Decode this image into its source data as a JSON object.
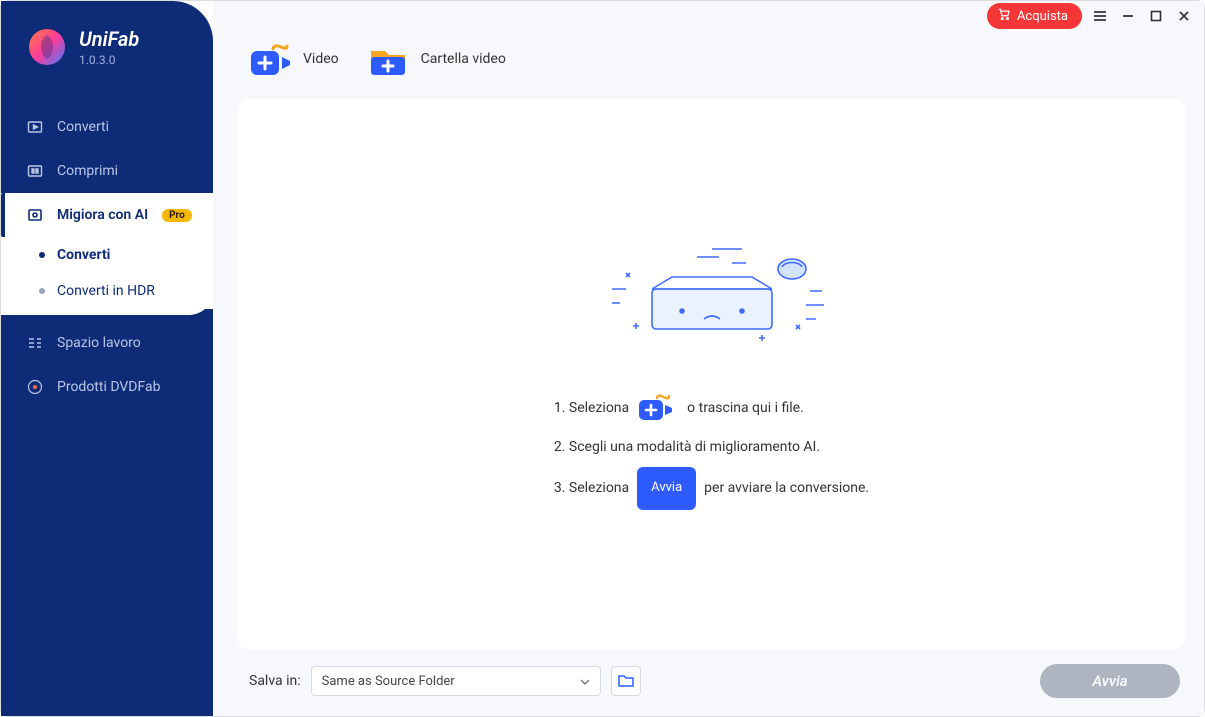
{
  "titlebar": {
    "buy_label": "Acquista"
  },
  "brand": {
    "name": "UniFab",
    "version": "1.0.3.0"
  },
  "sidebar": {
    "convert": "Converti",
    "compress": "Comprimi",
    "enhance_ai": "Migiora con AI",
    "pro_badge": "Pro",
    "sub_convert": "Converti",
    "sub_convert_hdr": "Converti in HDR",
    "workspace": "Spazio lavoro",
    "dvdfab_products": "Prodotti DVDFab"
  },
  "toolbar": {
    "video": "Video",
    "video_folder": "Cartella video"
  },
  "steps": {
    "s1a": "1. Seleziona",
    "s1b": "o trascina qui i file.",
    "s2": "2. Scegli una modalità di miglioramento AI.",
    "s3a": "3. Seleziona",
    "s3_chip": "Avvia",
    "s3b": "per avviare la conversione."
  },
  "footer": {
    "save_in": "Salva in:",
    "dest": "Same as Source Folder",
    "start": "Avvia"
  }
}
